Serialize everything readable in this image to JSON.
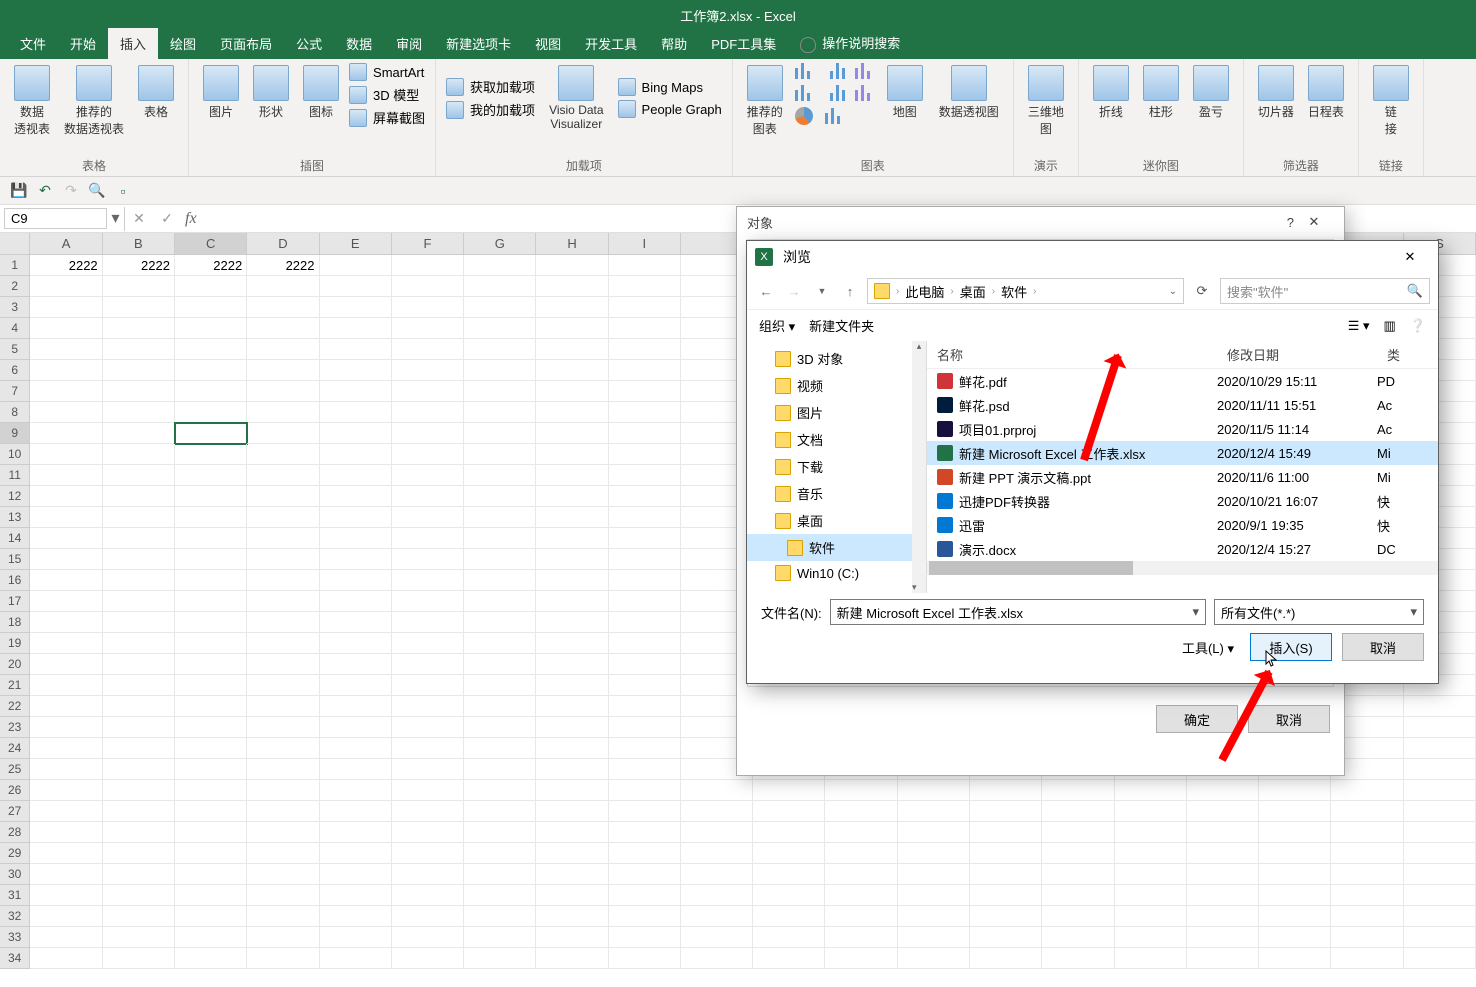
{
  "title": "工作簿2.xlsx  -  Excel",
  "tabs": [
    "文件",
    "开始",
    "插入",
    "绘图",
    "页面布局",
    "公式",
    "数据",
    "审阅",
    "新建选项卡",
    "视图",
    "开发工具",
    "帮助",
    "PDF工具集"
  ],
  "tellme": "操作说明搜索",
  "active_tab": 2,
  "ribbon": {
    "g1": {
      "label": "表格",
      "btns": [
        "数据\n透视表",
        "推荐的\n数据透视表",
        "表格"
      ]
    },
    "g2": {
      "label": "插图",
      "btns": [
        "图片",
        "形状",
        "图标"
      ],
      "list": [
        "SmartArt",
        "3D 模型",
        "屏幕截图"
      ]
    },
    "g3": {
      "label": "加载项",
      "list": [
        "获取加载项",
        "我的加载项"
      ],
      "btns": [
        "Visio Data\nVisualizer",
        "Bing Maps",
        "People Graph"
      ]
    },
    "g4": {
      "label": "图表",
      "btns": [
        "推荐的\n图表"
      ],
      "right": [
        "地图",
        "数据透视图"
      ]
    },
    "g5": {
      "label": "演示",
      "btns": [
        "三维地\n图"
      ]
    },
    "g6": {
      "label": "迷你图",
      "btns": [
        "折线",
        "柱形",
        "盈亏"
      ]
    },
    "g7": {
      "label": "筛选器",
      "btns": [
        "切片器",
        "日程表"
      ]
    },
    "g8": {
      "label": "链接",
      "btns": [
        "链\n接"
      ]
    }
  },
  "namebox": "C9",
  "columns": [
    "A",
    "B",
    "C",
    "D",
    "E",
    "F",
    "G",
    "H",
    "I",
    "",
    "",
    "",
    "",
    "",
    "",
    "",
    "",
    "",
    "",
    "S"
  ],
  "data_row": [
    "2222",
    "2222",
    "2222",
    "2222"
  ],
  "num_rows": 34,
  "sel": {
    "row": 9,
    "col": 2
  },
  "dlg_object": {
    "title": "对象",
    "ok": "确定",
    "cancel": "取消"
  },
  "dlg_browse": {
    "title": "浏览",
    "crumbs": [
      "此电脑",
      "桌面",
      "软件"
    ],
    "search_placeholder": "搜索\"软件\"",
    "organize": "组织",
    "newfolder": "新建文件夹",
    "tree": [
      {
        "t": "3D 对象"
      },
      {
        "t": "视频"
      },
      {
        "t": "图片"
      },
      {
        "t": "文档"
      },
      {
        "t": "下载"
      },
      {
        "t": "音乐"
      },
      {
        "t": "桌面"
      },
      {
        "t": "软件",
        "sel": true,
        "deep": true
      },
      {
        "t": "Win10 (C:)"
      }
    ],
    "headers": {
      "name": "名称",
      "date": "修改日期",
      "type": "类"
    },
    "files": [
      {
        "icon": "pdf",
        "name": "鲜花.pdf",
        "date": "2020/10/29 15:11",
        "type": "PD"
      },
      {
        "icon": "psd",
        "name": "鲜花.psd",
        "date": "2020/11/11 15:51",
        "type": "Ac"
      },
      {
        "icon": "pr",
        "name": "项目01.prproj",
        "date": "2020/11/5 11:14",
        "type": "Ac"
      },
      {
        "icon": "xl",
        "name": "新建 Microsoft Excel 工作表.xlsx",
        "date": "2020/12/4 15:49",
        "type": "Mi",
        "sel": true
      },
      {
        "icon": "ppt",
        "name": "新建 PPT 演示文稿.ppt",
        "date": "2020/11/6 11:00",
        "type": "Mi"
      },
      {
        "icon": "app",
        "name": "迅捷PDF转换器",
        "date": "2020/10/21 16:07",
        "type": "快"
      },
      {
        "icon": "app",
        "name": "迅雷",
        "date": "2020/9/1 19:35",
        "type": "快"
      },
      {
        "icon": "doc",
        "name": "演示.docx",
        "date": "2020/12/4 15:27",
        "type": "DC"
      }
    ],
    "fnlabel": "文件名(N):",
    "fnvalue": "新建 Microsoft Excel 工作表.xlsx",
    "filter": "所有文件(*.*)",
    "tools": "工具(L)",
    "insert": "插入(S)",
    "cancel": "取消"
  }
}
